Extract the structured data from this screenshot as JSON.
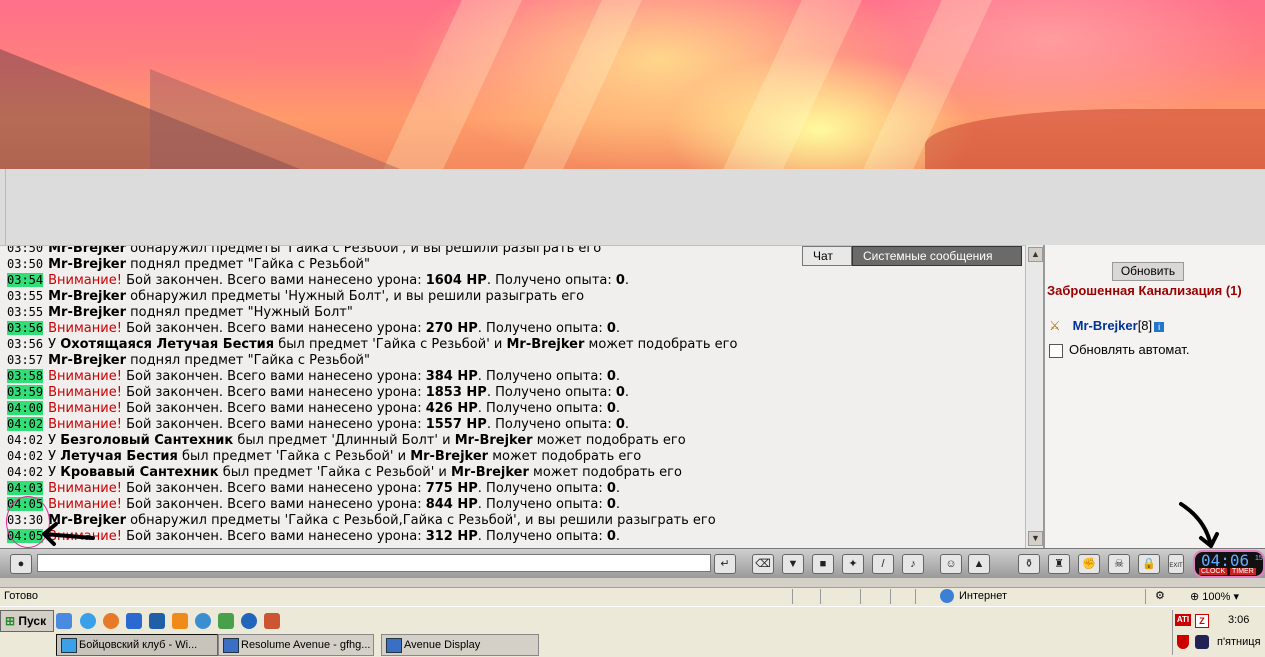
{
  "chat": {
    "tabs": [
      "Чат",
      "Системные сообщения"
    ],
    "lines": [
      {
        "ts": "03:50",
        "hl": false,
        "parts": [
          {
            "t": "Mr-Brejker",
            "b": true
          },
          {
            "t": " обнаружил предметы 'Гайка с Резьбой', и вы решили разыграть его"
          }
        ]
      },
      {
        "ts": "03:50",
        "hl": false,
        "parts": [
          {
            "t": "Mr-Brejker",
            "b": true
          },
          {
            "t": " поднял предмет \"Гайка с Резьбой\""
          }
        ]
      },
      {
        "ts": "03:54",
        "hl": true,
        "parts": [
          {
            "t": "Внимание!",
            "w": true
          },
          {
            "t": " Бой закончен. Всего вами нанесено урона: "
          },
          {
            "t": "1604 HP",
            "b": true
          },
          {
            "t": ". Получено опыта: "
          },
          {
            "t": "0",
            "b": true
          },
          {
            "t": "."
          }
        ]
      },
      {
        "ts": "03:55",
        "hl": false,
        "parts": [
          {
            "t": "Mr-Brejker",
            "b": true
          },
          {
            "t": " обнаружил предметы 'Нужный Болт', и вы решили разыграть его"
          }
        ]
      },
      {
        "ts": "03:55",
        "hl": false,
        "parts": [
          {
            "t": "Mr-Brejker",
            "b": true
          },
          {
            "t": " поднял предмет \"Нужный Болт\""
          }
        ]
      },
      {
        "ts": "03:56",
        "hl": true,
        "parts": [
          {
            "t": "Внимание!",
            "w": true
          },
          {
            "t": " Бой закончен. Всего вами нанесено урона: "
          },
          {
            "t": "270 HP",
            "b": true
          },
          {
            "t": ". Получено опыта: "
          },
          {
            "t": "0",
            "b": true
          },
          {
            "t": "."
          }
        ]
      },
      {
        "ts": "03:56",
        "hl": false,
        "parts": [
          {
            "t": "У "
          },
          {
            "t": "Охотящаяся Летучая Бестия",
            "b": true
          },
          {
            "t": " был предмет 'Гайка с Резьбой' и "
          },
          {
            "t": "Mr-Brejker",
            "b": true
          },
          {
            "t": " может подобрать его"
          }
        ]
      },
      {
        "ts": "03:57",
        "hl": false,
        "parts": [
          {
            "t": "Mr-Brejker",
            "b": true
          },
          {
            "t": " поднял предмет \"Гайка с Резьбой\""
          }
        ]
      },
      {
        "ts": "03:58",
        "hl": true,
        "parts": [
          {
            "t": "Внимание!",
            "w": true
          },
          {
            "t": " Бой закончен. Всего вами нанесено урона: "
          },
          {
            "t": "384 HP",
            "b": true
          },
          {
            "t": ". Получено опыта: "
          },
          {
            "t": "0",
            "b": true
          },
          {
            "t": "."
          }
        ]
      },
      {
        "ts": "03:59",
        "hl": true,
        "parts": [
          {
            "t": "Внимание!",
            "w": true
          },
          {
            "t": " Бой закончен. Всего вами нанесено урона: "
          },
          {
            "t": "1853 HP",
            "b": true
          },
          {
            "t": ". Получено опыта: "
          },
          {
            "t": "0",
            "b": true
          },
          {
            "t": "."
          }
        ]
      },
      {
        "ts": "04:00",
        "hl": true,
        "parts": [
          {
            "t": "Внимание!",
            "w": true
          },
          {
            "t": " Бой закончен. Всего вами нанесено урона: "
          },
          {
            "t": "426 HP",
            "b": true
          },
          {
            "t": ". Получено опыта: "
          },
          {
            "t": "0",
            "b": true
          },
          {
            "t": "."
          }
        ]
      },
      {
        "ts": "04:02",
        "hl": true,
        "parts": [
          {
            "t": "Внимание!",
            "w": true
          },
          {
            "t": " Бой закончен. Всего вами нанесено урона: "
          },
          {
            "t": "1557 HP",
            "b": true
          },
          {
            "t": ". Получено опыта: "
          },
          {
            "t": "0",
            "b": true
          },
          {
            "t": "."
          }
        ]
      },
      {
        "ts": "04:02",
        "hl": false,
        "parts": [
          {
            "t": "У "
          },
          {
            "t": "Безголовый Сантехник",
            "b": true
          },
          {
            "t": " был предмет 'Длинный Болт' и "
          },
          {
            "t": "Mr-Brejker",
            "b": true
          },
          {
            "t": " может подобрать его"
          }
        ]
      },
      {
        "ts": "04:02",
        "hl": false,
        "parts": [
          {
            "t": "У "
          },
          {
            "t": "Летучая Бестия",
            "b": true
          },
          {
            "t": " был предмет 'Гайка с Резьбой' и "
          },
          {
            "t": "Mr-Brejker",
            "b": true
          },
          {
            "t": " может подобрать его"
          }
        ]
      },
      {
        "ts": "04:02",
        "hl": false,
        "parts": [
          {
            "t": "У "
          },
          {
            "t": "Кровавый Сантехник",
            "b": true
          },
          {
            "t": " был предмет 'Гайка с Резьбой' и "
          },
          {
            "t": "Mr-Brejker",
            "b": true
          },
          {
            "t": " может подобрать его"
          }
        ]
      },
      {
        "ts": "04:03",
        "hl": true,
        "parts": [
          {
            "t": "Внимание!",
            "w": true
          },
          {
            "t": " Бой закончен. Всего вами нанесено урона: "
          },
          {
            "t": "775 HP",
            "b": true
          },
          {
            "t": ". Получено опыта: "
          },
          {
            "t": "0",
            "b": true
          },
          {
            "t": "."
          }
        ]
      },
      {
        "ts": "04:05",
        "hl": true,
        "parts": [
          {
            "t": "Внимание!",
            "w": true
          },
          {
            "t": " Бой закончен. Всего вами нанесено урона: "
          },
          {
            "t": "844 HP",
            "b": true
          },
          {
            "t": ". Получено опыта: "
          },
          {
            "t": "0",
            "b": true
          },
          {
            "t": "."
          }
        ]
      },
      {
        "ts": "03:30",
        "hl": false,
        "parts": [
          {
            "t": "Mr-Brejker",
            "b": true
          },
          {
            "t": " обнаружил предметы 'Гайка с Резьбой,Гайка с Резьбой', и вы решили разыграть его"
          }
        ]
      },
      {
        "ts": "04:05",
        "hl": true,
        "parts": [
          {
            "t": "Внимание!",
            "w": true
          },
          {
            "t": " Бой закончен. Всего вами нанесено урона: "
          },
          {
            "t": "312 HP",
            "b": true
          },
          {
            "t": ". Получено опыта: "
          },
          {
            "t": "0",
            "b": true
          },
          {
            "t": "."
          }
        ]
      }
    ]
  },
  "sidebar": {
    "refresh_label": "Обновить",
    "location": "Заброшенная Канализация (1)",
    "player_name": "Mr-Brejker",
    "player_level": "[8]",
    "auto_label": "Обновлять автомат."
  },
  "clock": {
    "time": "04:06",
    "seconds": "15",
    "clock_label": "CLOCK",
    "timer_label": "TIMER",
    "exit_label": "EXIT"
  },
  "statusbar": {
    "ready": "Готово",
    "zone": "Интернет",
    "zoom": "100%"
  },
  "taskbar": {
    "start_label": "Пуск",
    "tasks": [
      "Бойцовский клуб - Wi...",
      "Resolume Avenue - gfhg...",
      "Avenue Display"
    ],
    "time": "3:06",
    "day": "п'ятниця",
    "ati_label": "ATI",
    "z_label": "Z"
  },
  "colors": {
    "highlight": "#33dd77",
    "warning": "#cc0000",
    "location": "#990000",
    "nick": "#003399"
  }
}
